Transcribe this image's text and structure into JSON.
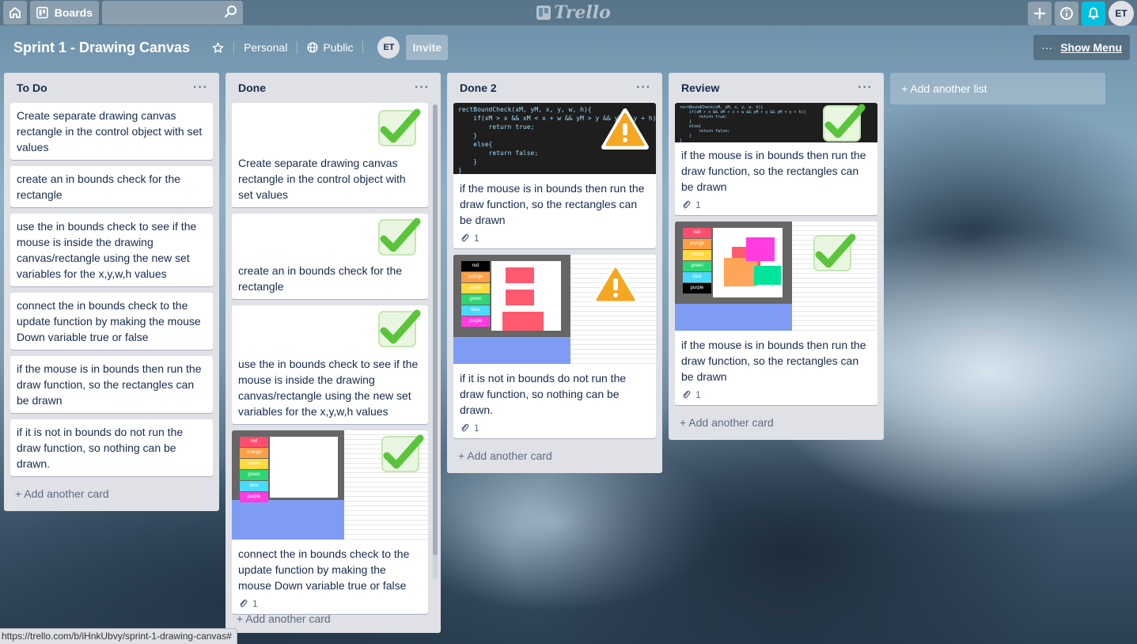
{
  "topbar": {
    "boards_label": "Boards",
    "search_placeholder": "",
    "logo_text": "Trello",
    "avatar_initials": "ET"
  },
  "board": {
    "title": "Sprint 1 - Drawing Canvas",
    "team_label": "Personal",
    "visibility_label": "Public",
    "member_initials": "ET",
    "invite_label": "Invite",
    "show_menu_label": "Show Menu",
    "more_label": "···"
  },
  "lists": [
    {
      "title": "To Do",
      "menu": "···",
      "add_card": "+ Add another card",
      "cards": [
        {
          "text": "Create separate drawing canvas rectangle in the control object with set values"
        },
        {
          "text": "create an in bounds check for the rectangle"
        },
        {
          "text": "use the in bounds check to see if the mouse is inside the drawing canvas/rectangle using the new set variables for the x,y,w,h values"
        },
        {
          "text": "connect the in bounds check to the update function by making the mouse Down variable true or false"
        },
        {
          "text": "if the mouse is in bounds then run the draw function, so the rectangles can be drawn"
        },
        {
          "text": "if it is not in bounds do not run the draw function, so nothing can be drawn."
        }
      ]
    },
    {
      "title": "Done",
      "menu": "···",
      "add_card": "+ Add another card",
      "cards": [
        {
          "text": "Create separate drawing canvas rectangle in the control object with set values"
        },
        {
          "text": "create an in bounds check for the rectangle"
        },
        {
          "text": "use the in bounds check to see if the mouse is inside the drawing canvas/rectangle using the new set variables for the x,y,w,h values"
        },
        {
          "text": "connect the in bounds check to the update function by making the mouse Down variable true or false",
          "attachments": "1"
        }
      ]
    },
    {
      "title": "Done 2",
      "menu": "···",
      "add_card": "+ Add another card",
      "cards": [
        {
          "text": "if the mouse is in bounds then run the draw function, so the rectangles can be drawn",
          "attachments": "1"
        },
        {
          "text": "if it is not in bounds do not run the draw function, so nothing can be drawn.",
          "attachments": "1"
        }
      ]
    },
    {
      "title": "Review",
      "menu": "···",
      "add_card": "+ Add another card",
      "cards": [
        {
          "text": "if the mouse is in bounds then run the draw function, so the rectangles can be drawn",
          "attachments": "1"
        },
        {
          "text": "if the mouse is in bounds then run the draw function, so the rectangles can be drawn",
          "attachments": "1"
        }
      ]
    }
  ],
  "add_list": "+ Add another list",
  "code_snippet": "rectBoundCheck(xM, yM, x, y, w, h){\n    if(xM > x && xM < x + w && yM > y && yM < y + h){\n        return true;\n    }\n    else{\n        return false;\n    }\n}",
  "palette_labels": [
    "red",
    "orange",
    "yellow",
    "green",
    "blue",
    "purple"
  ],
  "status_url": "https://trello.com/b/iHnkUbvy/sprint-1-drawing-canvas#",
  "colors": {
    "accent": "#00c2e0",
    "check": "#5ac53b",
    "warning": "#f5a623",
    "list_bg": "#dfe1e6"
  }
}
